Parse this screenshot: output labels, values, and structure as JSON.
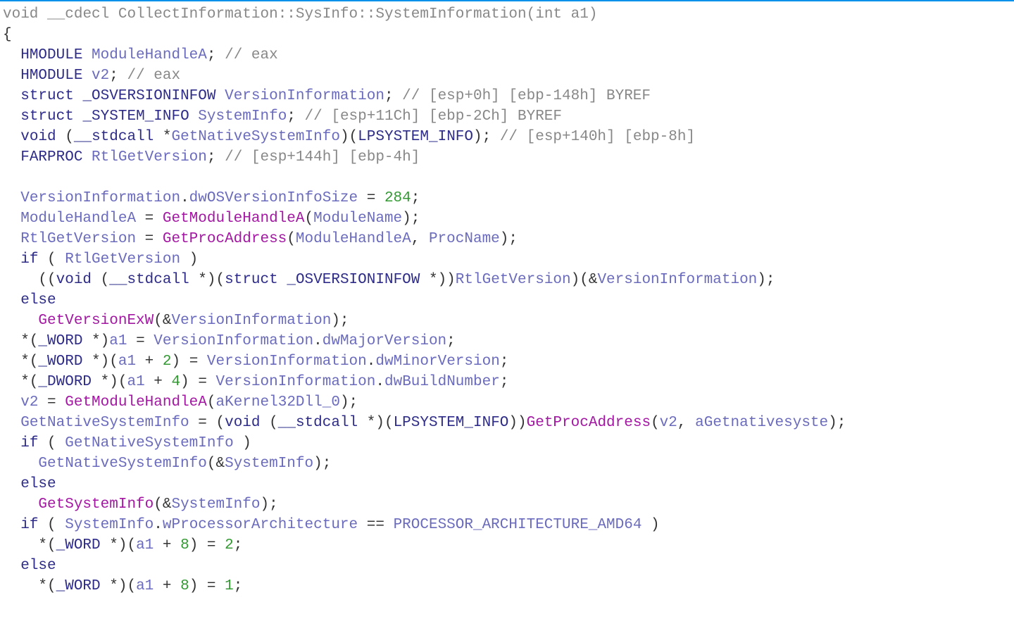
{
  "sig": {
    "ret": "void",
    "cc": "__cdecl",
    "ns1": "CollectInformation",
    "ns2": "SysInfo",
    "fn": "SystemInformation",
    "argType": "int",
    "argName": "a1"
  },
  "decl": {
    "hmodule": "HMODULE",
    "mh": "ModuleHandleA",
    "mh_c": "// eax",
    "v2": "v2",
    "v2_c": "// eax",
    "struct": "struct",
    "osv_t": "_OSVERSIONINFOW",
    "osv": "VersionInformation",
    "osv_c": "// [esp+0h] [ebp-148h] BYREF",
    "si_t": "_SYSTEM_INFO",
    "si": "SystemInfo",
    "si_c": "// [esp+11Ch] [ebp-2Ch] BYREF",
    "void": "void",
    "stdcall": "__stdcall",
    "gnsi": "GetNativeSystemInfo",
    "lpsi": "LPSYSTEM_INFO",
    "gnsi_c": "// [esp+140h] [ebp-8h]",
    "farproc": "FARPROC",
    "rgv": "RtlGetVersion",
    "rgv_c": "// [esp+144h] [ebp-4h]"
  },
  "body": {
    "vi": "VersionInformation",
    "dwOSVIS": "dwOSVersionInfoSize",
    "n284": "284",
    "mh": "ModuleHandleA",
    "gmha": "GetModuleHandleA",
    "modname": "ModuleName",
    "rgv": "RtlGetVersion",
    "gpa": "GetProcAddress",
    "procname": "ProcName",
    "kw_if": "if",
    "kw_else": "else",
    "void": "void",
    "stdcall": "__stdcall",
    "struct": "struct",
    "osv_t": "_OSVERSIONINFOW",
    "gvew": "GetVersionExW",
    "word": "_WORD",
    "dword": "_DWORD",
    "a1": "a1",
    "dwMaj": "dwMajorVersion",
    "dwMin": "dwMinorVersion",
    "dwBld": "dwBuildNumber",
    "v2": "v2",
    "ak": "aKernel32Dll_0",
    "gnsi": "GetNativeSystemInfo",
    "lpsi": "LPSYSTEM_INFO",
    "agns": "aGetnativesyste",
    "gsi": "GetSystemInfo",
    "si": "SystemInfo",
    "wpa": "wProcessorArchitecture",
    "paa": "PROCESSOR_ARCHITECTURE_AMD64",
    "n2": "2",
    "n4": "4",
    "n8": "8",
    "n1": "1",
    "nlit2": "2",
    "nlit1": "1"
  }
}
